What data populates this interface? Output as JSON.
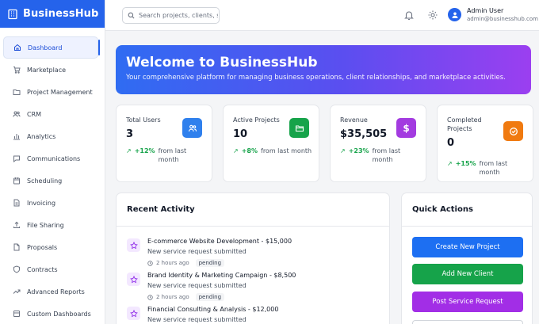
{
  "app": {
    "name": "BusinessHub"
  },
  "sidebar": {
    "items": [
      {
        "label": "Dashboard",
        "icon": "home-icon"
      },
      {
        "label": "Marketplace",
        "icon": "cart-icon"
      },
      {
        "label": "Project Management",
        "icon": "folder-icon"
      },
      {
        "label": "CRM",
        "icon": "users-icon"
      },
      {
        "label": "Analytics",
        "icon": "bar-chart-icon"
      },
      {
        "label": "Communications",
        "icon": "chat-icon"
      },
      {
        "label": "Scheduling",
        "icon": "calendar-icon"
      },
      {
        "label": "Invoicing",
        "icon": "document-icon"
      },
      {
        "label": "File Sharing",
        "icon": "upload-icon"
      },
      {
        "label": "Proposals",
        "icon": "file-text-icon"
      },
      {
        "label": "Contracts",
        "icon": "shield-icon"
      },
      {
        "label": "Advanced Reports",
        "icon": "trending-icon"
      },
      {
        "label": "Custom Dashboards",
        "icon": "layout-icon"
      }
    ]
  },
  "header": {
    "search": {
      "placeholder": "Search projects, clients, s",
      "value": ""
    },
    "user": {
      "name": "Admin User",
      "email": "admin@businesshub.com"
    }
  },
  "banner": {
    "title": "Welcome to BusinessHub",
    "subtitle": "Your comprehensive platform for managing business operations, client relationships, and marketplace activities."
  },
  "stats": [
    {
      "label": "Total Users",
      "value": "3",
      "change": "+12%",
      "period": "from last month",
      "color": "#2f80ed",
      "icon": "users-icon"
    },
    {
      "label": "Active Projects",
      "value": "10",
      "change": "+8%",
      "period": "from last month",
      "color": "#16a34a",
      "icon": "folder-open-icon"
    },
    {
      "label": "Revenue",
      "value": "$35,505",
      "change": "+23%",
      "period": "from last month",
      "color": "#a33be0",
      "icon": "dollar-icon"
    },
    {
      "label": "Completed Projects",
      "value": "0",
      "change": "+15%",
      "period": "from last month",
      "color": "#f07a10",
      "icon": "check-icon"
    }
  ],
  "recent": {
    "title": "Recent Activity",
    "items": [
      {
        "title": "E-commerce Website Development - $15,000",
        "desc": "New service request submitted",
        "time": "2 hours ago",
        "status": "pending"
      },
      {
        "title": "Brand Identity & Marketing Campaign - $8,500",
        "desc": "New service request submitted",
        "time": "2 hours ago",
        "status": "pending"
      },
      {
        "title": "Financial Consulting & Analysis - $12,000",
        "desc": "New service request submitted",
        "time": "",
        "status": ""
      }
    ]
  },
  "quick": {
    "title": "Quick Actions",
    "buttons": [
      {
        "label": "Create New Project",
        "color": "#1d6ff2"
      },
      {
        "label": "Add New Client",
        "color": "#16a34a"
      },
      {
        "label": "Post Service Request",
        "color": "#a22ee6"
      }
    ]
  }
}
